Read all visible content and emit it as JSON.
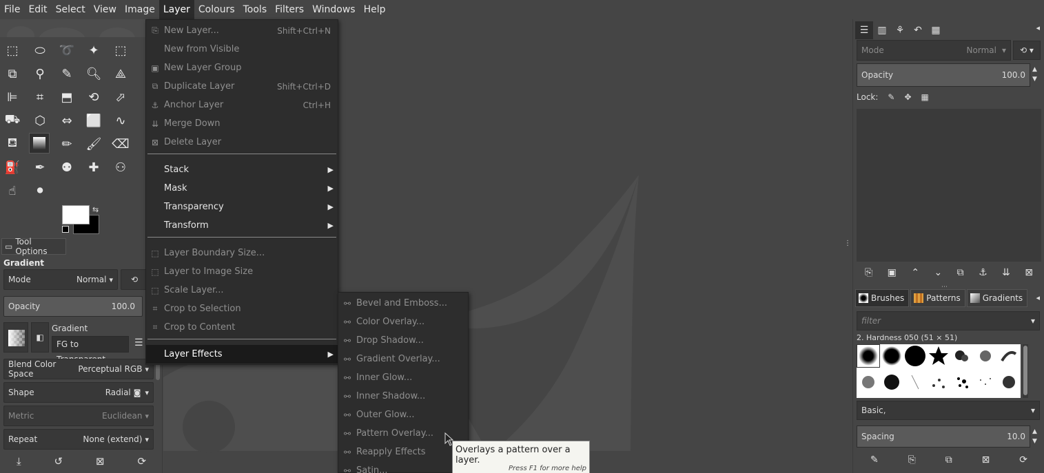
{
  "menubar": {
    "items": [
      "File",
      "Edit",
      "Select",
      "View",
      "Image",
      "Layer",
      "Colours",
      "Tools",
      "Filters",
      "Windows",
      "Help"
    ],
    "active": "Layer"
  },
  "layer_menu": {
    "items": [
      {
        "label": "New Layer...",
        "shortcut": "Shift+Ctrl+N",
        "icon": "new-layer-icon"
      },
      {
        "label": "New from Visible",
        "shortcut": "",
        "icon": ""
      },
      {
        "label": "New Layer Group",
        "shortcut": "",
        "icon": "layer-group-icon"
      },
      {
        "label": "Duplicate Layer",
        "shortcut": "Shift+Ctrl+D",
        "icon": "duplicate-icon"
      },
      {
        "label": "Anchor Layer",
        "shortcut": "Ctrl+H",
        "icon": "anchor-icon"
      },
      {
        "label": "Merge Down",
        "shortcut": "",
        "icon": "merge-down-icon"
      },
      {
        "label": "Delete Layer",
        "shortcut": "",
        "icon": "delete-icon"
      }
    ],
    "submenus": [
      "Stack",
      "Mask",
      "Transparency",
      "Transform"
    ],
    "size_items": [
      {
        "label": "Layer Boundary Size...",
        "icon": "boundary-icon"
      },
      {
        "label": "Layer to Image Size",
        "icon": "to-image-icon"
      },
      {
        "label": "Scale Layer...",
        "icon": "scale-icon"
      },
      {
        "label": "Crop to Selection",
        "icon": "crop-icon"
      },
      {
        "label": "Crop to Content",
        "icon": "crop-content-icon"
      }
    ],
    "effects_label": "Layer Effects"
  },
  "effects_menu": {
    "items": [
      "Bevel and Emboss...",
      "Color Overlay...",
      "Drop Shadow...",
      "Gradient Overlay...",
      "Inner Glow...",
      "Inner Shadow...",
      "Outer Glow...",
      "Pattern Overlay...",
      "Reapply Effects",
      "Satin..."
    ]
  },
  "tooltip": {
    "text": "Overlays a pattern over a layer.",
    "help": "Press F1 for more help"
  },
  "tool_options": {
    "tab_label": "Tool Options",
    "heading": "Gradient",
    "mode_label": "Mode",
    "mode_value": "Normal",
    "opacity_label": "Opacity",
    "opacity_value": "100.0",
    "gradient_label": "Gradient",
    "gradient_name": "FG to Transparent",
    "blend_label": "Blend Color Space",
    "blend_value": "Perceptual RGB",
    "shape_label": "Shape",
    "shape_value": "Radial",
    "metric_label": "Metric",
    "metric_value": "Euclidean",
    "repeat_label": "Repeat",
    "repeat_value": "None (extend)"
  },
  "layers_dock": {
    "mode_label": "Mode",
    "mode_value": "Normal",
    "opacity_label": "Opacity",
    "opacity_value": "100.0",
    "lock_label": "Lock:"
  },
  "brushes_dock": {
    "tabs": [
      "Brushes",
      "Patterns",
      "Gradients"
    ],
    "filter_placeholder": "filter",
    "current_brush": "2. Hardness 050 (51 × 51)",
    "tag_value": "Basic,",
    "spacing_label": "Spacing",
    "spacing_value": "10.0"
  }
}
